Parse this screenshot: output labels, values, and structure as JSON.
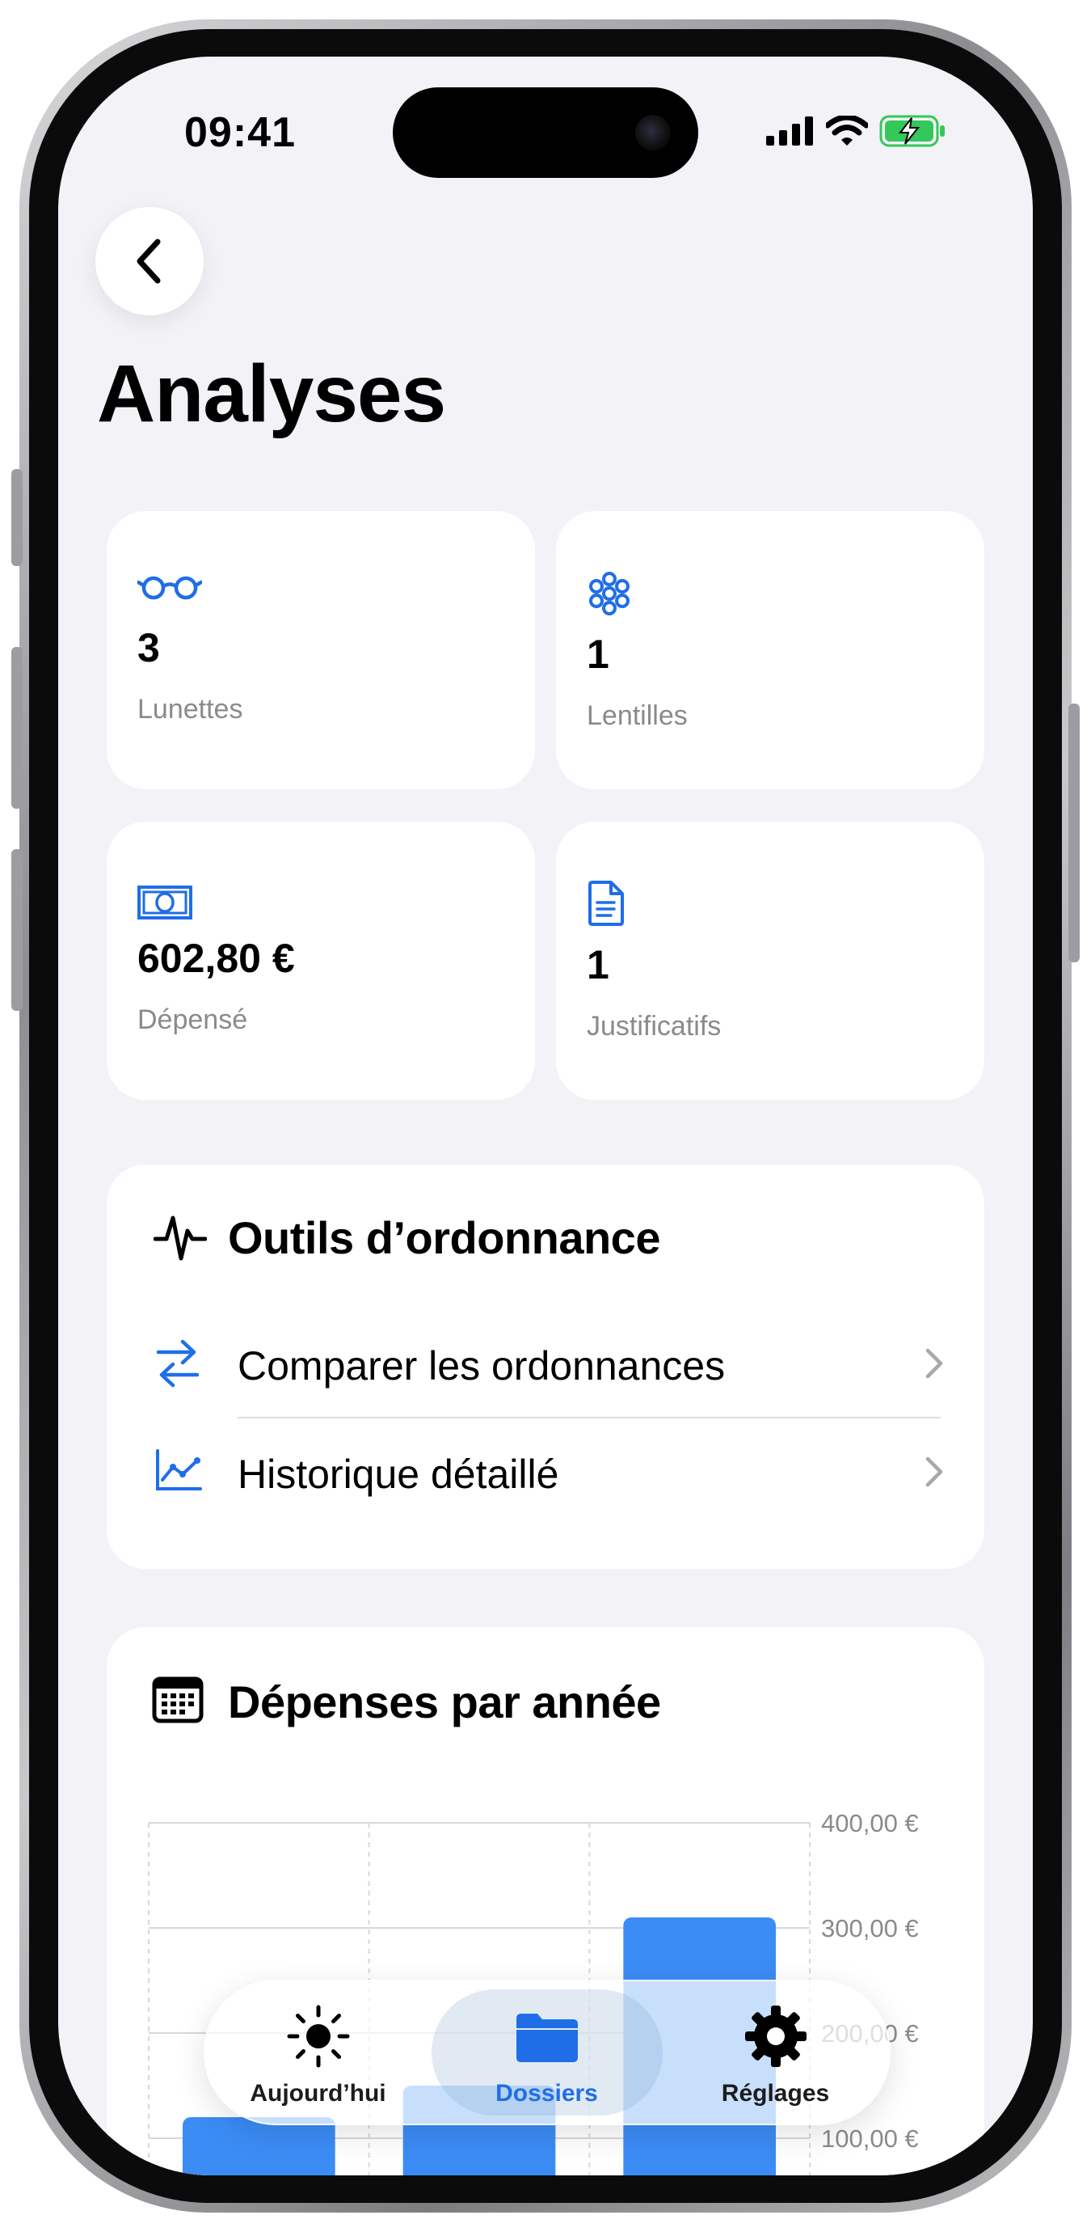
{
  "status_bar": {
    "time": "09:41"
  },
  "page": {
    "title": "Analyses"
  },
  "stats": [
    {
      "icon": "glasses-icon",
      "value": "3",
      "label": "Lunettes"
    },
    {
      "icon": "contact-lens-icon",
      "value": "1",
      "label": "Lentilles"
    },
    {
      "icon": "banknote-icon",
      "value": "602,80 €",
      "label": "Dépensé"
    },
    {
      "icon": "document-icon",
      "value": "1",
      "label": "Justificatifs"
    }
  ],
  "tools": {
    "title": "Outils d’ordonnance",
    "items": [
      {
        "label": "Comparer les ordonnances",
        "icon": "arrows-swap-icon"
      },
      {
        "label": "Historique détaillé",
        "icon": "line-chart-icon"
      }
    ]
  },
  "expenses": {
    "title": "Dépenses par année"
  },
  "chart_data": {
    "type": "bar",
    "title": "Dépenses par année",
    "y_tick_labels": [
      "400,00 €",
      "300,00 €",
      "200,00 €",
      "100,00 €"
    ],
    "ylim": [
      0,
      400
    ],
    "grid": true,
    "values": [
      120,
      150,
      310
    ]
  },
  "tabbar": {
    "tabs": [
      {
        "label": "Aujourd’hui",
        "icon": "sun-icon",
        "active": false
      },
      {
        "label": "Dossiers",
        "icon": "folder-icon",
        "active": true
      },
      {
        "label": "Réglages",
        "icon": "gear-icon",
        "active": false
      }
    ]
  },
  "colors": {
    "accent": "#1f6ee8",
    "bar": "#3b8cf5",
    "background": "#f2f2f7"
  }
}
